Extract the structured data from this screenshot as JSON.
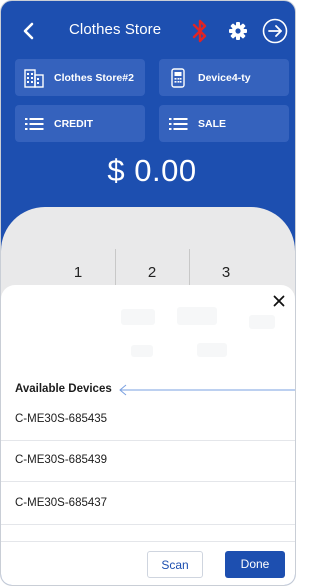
{
  "header": {
    "title": "Clothes Store",
    "back_icon": "chevron-left-icon",
    "bluetooth_icon": "bluetooth-icon",
    "settings_icon": "gear-icon",
    "logout_icon": "logout-icon"
  },
  "selectors": {
    "store": "Clothes Store#2",
    "device": "Device4-ty",
    "payment_type": "CREDIT",
    "transaction_type": "SALE"
  },
  "amount": "$ 0.00",
  "keypad": {
    "keys": [
      "1",
      "2",
      "3"
    ]
  },
  "sheet": {
    "section_title": "Available Devices",
    "devices": [
      "C-ME30S-685435",
      "C-ME30S-685439",
      "C-ME30S-685437"
    ],
    "scan_label": "Scan",
    "done_label": "Done"
  },
  "colors": {
    "primary": "#1d4fb0",
    "card": "#3562bd",
    "bluetooth": "#e02424",
    "arrow": "#7aa0e0"
  }
}
